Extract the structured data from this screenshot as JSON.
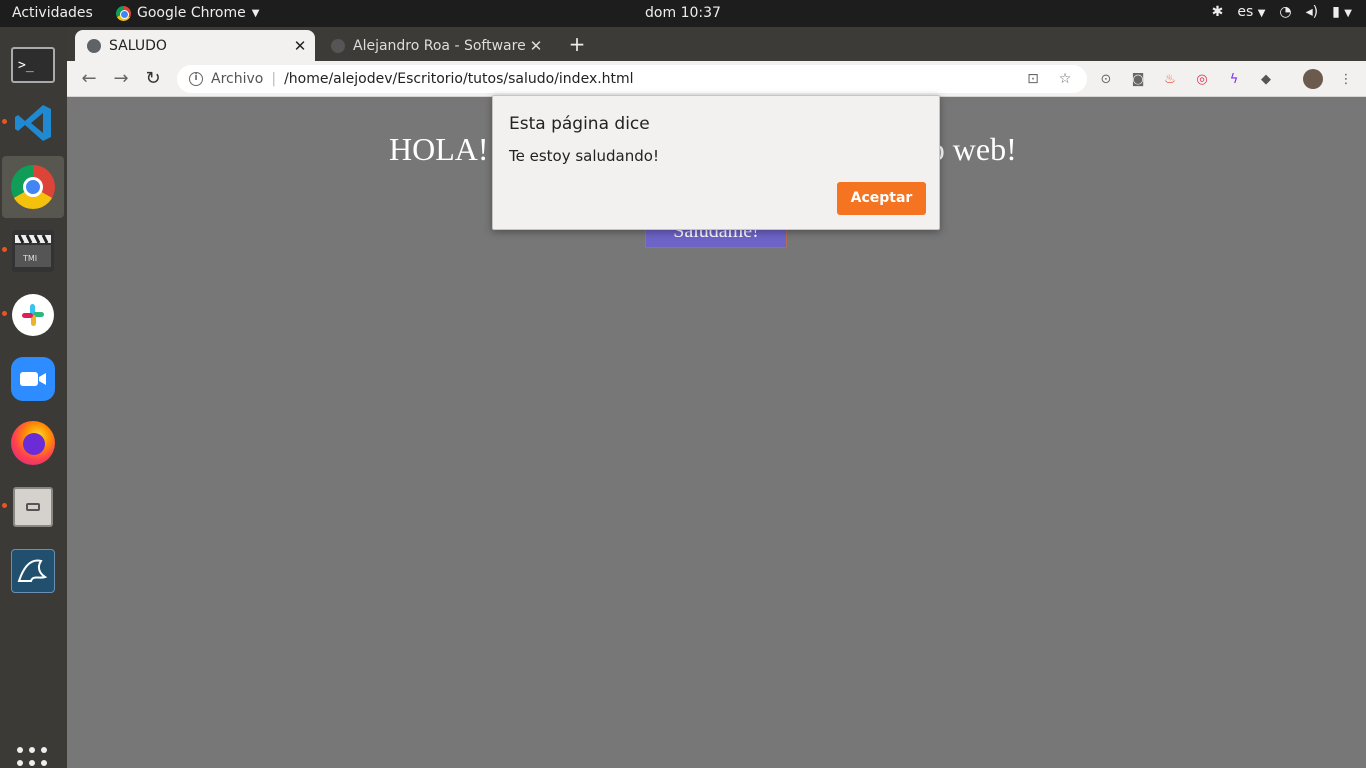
{
  "topbar": {
    "activities": "Actividades",
    "app_name": "Google Chrome",
    "clock": "dom 10:37",
    "language": "es"
  },
  "dock": {
    "items": [
      "terminal-icon",
      "vscode-icon",
      "chrome-icon",
      "clapper-icon",
      "slack-icon",
      "zoom-icon",
      "firefox-icon",
      "files-icon",
      "mysql-workbench-icon"
    ],
    "show_apps": "apps-grid-icon"
  },
  "browser": {
    "tabs": [
      {
        "title": "SALUDO"
      },
      {
        "title": "Alejandro Roa - Software"
      }
    ],
    "new_tab": "+",
    "omnibox": {
      "scheme_label": "Archivo",
      "url": "/home/alejodev/Escritorio/tutos/saludo/index.html"
    }
  },
  "page": {
    "heading_left": "HOLA!",
    "heading_right": "tio web!",
    "button_label": "Saludame!"
  },
  "dialog": {
    "title": "Esta página dice",
    "message": "Te estoy saludando!",
    "ok_label": "Aceptar"
  },
  "colors": {
    "accent": "#f47421",
    "page_bg": "#777777",
    "button_bg": "#6e64c8"
  }
}
